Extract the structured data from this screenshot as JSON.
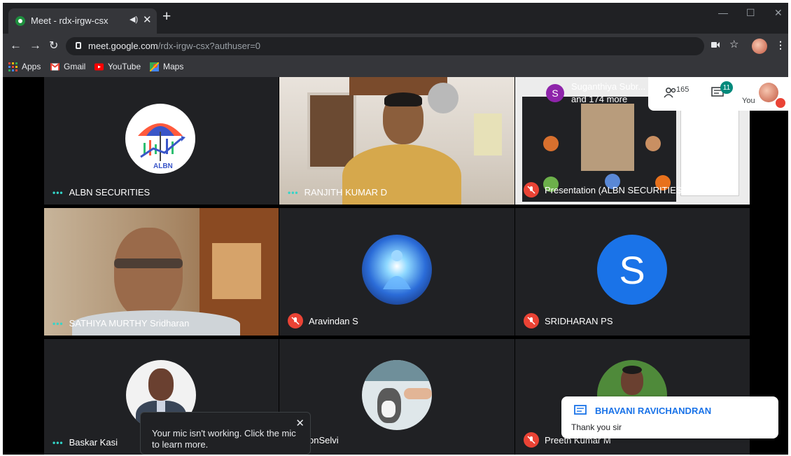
{
  "browser": {
    "tab_title": "Meet - rdx-irgw-csx",
    "url_host": "meet.google.com",
    "url_path": "/rdx-irgw-csx?authuser=0",
    "bookmarks": [
      {
        "label": "Apps",
        "icon": "apps-grid-icon"
      },
      {
        "label": "Gmail",
        "icon": "gmail-icon"
      },
      {
        "label": "YouTube",
        "icon": "youtube-icon"
      },
      {
        "label": "Maps",
        "icon": "maps-icon"
      }
    ]
  },
  "meeting": {
    "pinned": {
      "name": "Suganthiya Subr...",
      "more": "and 174 more",
      "initial": "S"
    },
    "participant_count": "165",
    "chat_badge": "11",
    "self_label": "You"
  },
  "tiles": [
    {
      "name": "ALBN SECURITIES",
      "state": "speaking",
      "logo_text": "ALBN"
    },
    {
      "name": "RANJITH KUMAR D",
      "state": "speaking"
    },
    {
      "name": "Presentation (ALBN SECURITIES)",
      "state": "muted"
    },
    {
      "name": "SATHIYA MURTHY Sridharan",
      "state": "speaking"
    },
    {
      "name": "Aravindan S",
      "state": "muted"
    },
    {
      "name": "SRIDHARAN PS",
      "state": "muted",
      "initial": "S"
    },
    {
      "name": "Baskar Kasi",
      "state": "speaking"
    },
    {
      "name": "onSelvi",
      "state": "muted"
    },
    {
      "name": "Preeth Kumar M",
      "state": "muted"
    }
  ],
  "toast": {
    "message": "Your mic isn't working. Click the mic to learn more."
  },
  "chat": {
    "sender": "BHAVANI RAVICHANDRAN",
    "message": "Thank you sir"
  },
  "colors": {
    "meet_bg": "#202124",
    "mute_red": "#ea4335",
    "speaking_teal": "#34d4c8",
    "accent_blue": "#1a73e8"
  }
}
